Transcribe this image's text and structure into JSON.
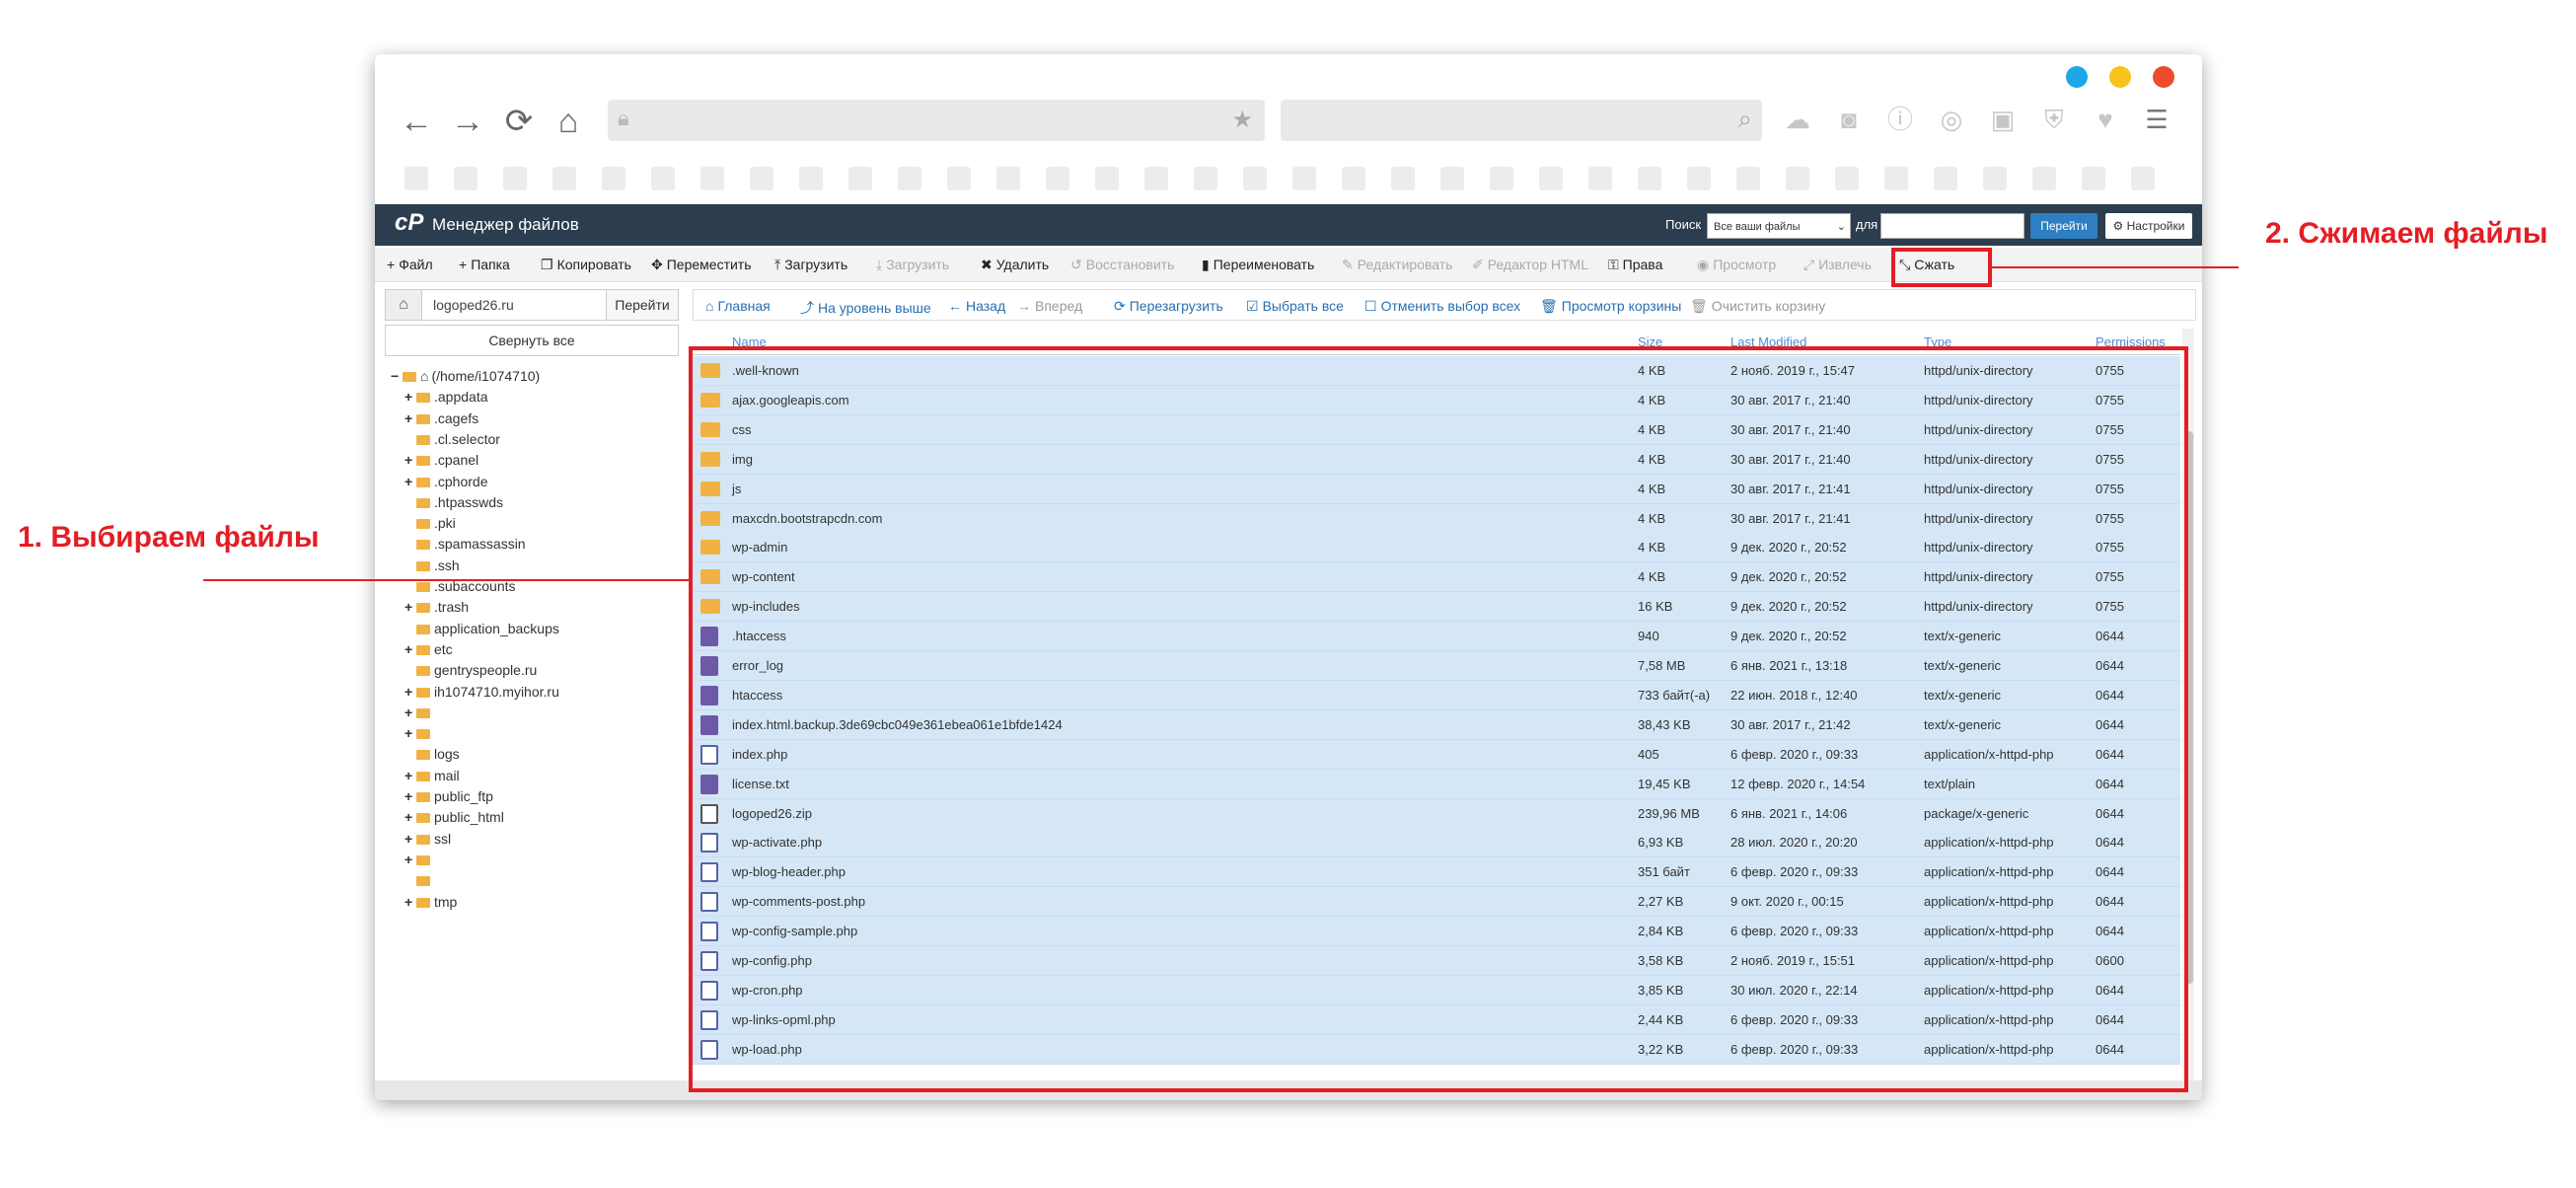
{
  "window_controls": {
    "blue": "#1ea7e8",
    "yellow": "#f7c21a",
    "red": "#ee4a2c"
  },
  "browser": {
    "nav_icons": [
      "back-arrow-icon",
      "forward-arrow-icon",
      "reload-icon",
      "home-icon"
    ],
    "toolbar_icons": [
      "download-cloud-icon",
      "camera-icon",
      "alert-icon",
      "broadcast-icon",
      "briefcase-icon",
      "shield-check-icon",
      "heart-icon",
      "hamburger-menu-icon"
    ]
  },
  "header": {
    "app_title": "Менеджер файлов",
    "search_label": "Поиск",
    "scope_value": "Все ваши файлы",
    "for_label": "для",
    "go_label": "Перейти",
    "settings_label": "Настройки"
  },
  "toolbar": [
    {
      "label": "Файл",
      "icon": "+",
      "disabled": false
    },
    {
      "label": "Папка",
      "icon": "+",
      "disabled": false
    },
    {
      "label": "Копировать",
      "icon": "❐",
      "disabled": false
    },
    {
      "label": "Переместить",
      "icon": "✥",
      "disabled": false
    },
    {
      "label": "Загрузить",
      "icon": "⤒",
      "disabled": false
    },
    {
      "label": "Загрузить",
      "icon": "⤓",
      "disabled": true
    },
    {
      "label": "Удалить",
      "icon": "✖",
      "disabled": false
    },
    {
      "label": "Восстановить",
      "icon": "↺",
      "disabled": true
    },
    {
      "label": "Переименовать",
      "icon": "▮",
      "disabled": false
    },
    {
      "label": "Редактировать",
      "icon": "✎",
      "disabled": true
    },
    {
      "label": "Редактор HTML",
      "icon": "✐",
      "disabled": true
    },
    {
      "label": "Права",
      "icon": "⚿",
      "disabled": false
    },
    {
      "label": "Просмотр",
      "icon": "◉",
      "disabled": true
    },
    {
      "label": "Извлечь",
      "icon": "⤢",
      "disabled": true
    },
    {
      "label": "Сжать",
      "icon": "⤡",
      "disabled": false
    }
  ],
  "sidebar": {
    "path_value": "logoped26.ru",
    "path_go": "Перейти",
    "collapse_all": "Свернуть все",
    "tree": [
      {
        "label": "(/home/i1074710)",
        "prefix": "−",
        "depth": 0
      },
      {
        "label": ".appdata",
        "prefix": "+",
        "depth": 1
      },
      {
        "label": ".cagefs",
        "prefix": "+",
        "depth": 1
      },
      {
        "label": ".cl.selector",
        "prefix": "",
        "depth": 1
      },
      {
        "label": ".cpanel",
        "prefix": "+",
        "depth": 1
      },
      {
        "label": ".cphorde",
        "prefix": "+",
        "depth": 1
      },
      {
        "label": ".htpasswds",
        "prefix": "",
        "depth": 1
      },
      {
        "label": ".pki",
        "prefix": "",
        "depth": 1
      },
      {
        "label": ".spamassassin",
        "prefix": "",
        "depth": 1
      },
      {
        "label": ".ssh",
        "prefix": "",
        "depth": 1
      },
      {
        "label": ".subaccounts",
        "prefix": "",
        "depth": 1
      },
      {
        "label": ".trash",
        "prefix": "+",
        "depth": 1
      },
      {
        "label": "application_backups",
        "prefix": "",
        "depth": 1
      },
      {
        "label": "etc",
        "prefix": "+",
        "depth": 1
      },
      {
        "label": "gentryspeople.ru",
        "prefix": "",
        "depth": 1
      },
      {
        "label": "ih1074710.myihor.ru",
        "prefix": "+",
        "depth": 1
      },
      {
        "label": "",
        "prefix": "+",
        "depth": 1
      },
      {
        "label": "",
        "prefix": "+",
        "depth": 1
      },
      {
        "label": "logs",
        "prefix": "",
        "depth": 1
      },
      {
        "label": "mail",
        "prefix": "+",
        "depth": 1
      },
      {
        "label": "public_ftp",
        "prefix": "+",
        "depth": 1
      },
      {
        "label": "public_html",
        "prefix": "+",
        "depth": 1
      },
      {
        "label": "ssl",
        "prefix": "+",
        "depth": 1
      },
      {
        "label": "",
        "prefix": "+",
        "depth": 1
      },
      {
        "label": "",
        "prefix": "",
        "depth": 1
      },
      {
        "label": "tmp",
        "prefix": "+",
        "depth": 1
      }
    ]
  },
  "navbar": [
    {
      "label": "Главная",
      "icon": "⌂",
      "disabled": false
    },
    {
      "label": "На уровень выше",
      "icon": "⤴",
      "disabled": false
    },
    {
      "label": "Назад",
      "icon": "←",
      "disabled": false
    },
    {
      "label": "Вперед",
      "icon": "→",
      "disabled": true
    },
    {
      "label": "Перезагрузить",
      "icon": "⟳",
      "disabled": false
    },
    {
      "label": "Выбрать все",
      "icon": "☑",
      "disabled": false
    },
    {
      "label": "Отменить выбор всех",
      "icon": "☐",
      "disabled": false
    },
    {
      "label": "Просмотр корзины",
      "icon": "🗑",
      "disabled": false
    },
    {
      "label": "Очистить корзину",
      "icon": "🗑",
      "disabled": true
    }
  ],
  "table": {
    "columns": [
      "Name",
      "Size",
      "Last Modified",
      "Type",
      "Permissions"
    ],
    "rows": [
      {
        "icon": "folder",
        "name": ".well-known",
        "size": "4 KB",
        "modified": "2 нояб. 2019 г., 15:47",
        "type": "httpd/unix-directory",
        "perm": "0755"
      },
      {
        "icon": "folder",
        "name": "ajax.googleapis.com",
        "size": "4 KB",
        "modified": "30 авг. 2017 г., 21:40",
        "type": "httpd/unix-directory",
        "perm": "0755"
      },
      {
        "icon": "folder",
        "name": "css",
        "size": "4 KB",
        "modified": "30 авг. 2017 г., 21:40",
        "type": "httpd/unix-directory",
        "perm": "0755"
      },
      {
        "icon": "folder",
        "name": "img",
        "size": "4 KB",
        "modified": "30 авг. 2017 г., 21:40",
        "type": "httpd/unix-directory",
        "perm": "0755"
      },
      {
        "icon": "folder",
        "name": "js",
        "size": "4 KB",
        "modified": "30 авг. 2017 г., 21:41",
        "type": "httpd/unix-directory",
        "perm": "0755"
      },
      {
        "icon": "folder",
        "name": "maxcdn.bootstrapcdn.com",
        "size": "4 KB",
        "modified": "30 авг. 2017 г., 21:41",
        "type": "httpd/unix-directory",
        "perm": "0755"
      },
      {
        "icon": "folder",
        "name": "wp-admin",
        "size": "4 KB",
        "modified": "9 дек. 2020 г., 20:52",
        "type": "httpd/unix-directory",
        "perm": "0755"
      },
      {
        "icon": "folder",
        "name": "wp-content",
        "size": "4 KB",
        "modified": "9 дек. 2020 г., 20:52",
        "type": "httpd/unix-directory",
        "perm": "0755"
      },
      {
        "icon": "folder",
        "name": "wp-includes",
        "size": "16 KB",
        "modified": "9 дек. 2020 г., 20:52",
        "type": "httpd/unix-directory",
        "perm": "0755"
      },
      {
        "icon": "text",
        "name": ".htaccess",
        "size": "940",
        "modified": "9 дек. 2020 г., 20:52",
        "type": "text/x-generic",
        "perm": "0644"
      },
      {
        "icon": "text",
        "name": "error_log",
        "size": "7,58 MB",
        "modified": "6 янв. 2021 г., 13:18",
        "type": "text/x-generic",
        "perm": "0644"
      },
      {
        "icon": "text",
        "name": "htaccess",
        "size": "733 байт(-а)",
        "modified": "22 июн. 2018 г., 12:40",
        "type": "text/x-generic",
        "perm": "0644"
      },
      {
        "icon": "text",
        "name": "index.html.backup.3de69cbc049e361ebea061e1bfde1424",
        "size": "38,43 KB",
        "modified": "30 авг. 2017 г., 21:42",
        "type": "text/x-generic",
        "perm": "0644"
      },
      {
        "icon": "php",
        "name": "index.php",
        "size": "405",
        "modified": "6 февр. 2020 г., 09:33",
        "type": "application/x-httpd-php",
        "perm": "0644"
      },
      {
        "icon": "text",
        "name": "license.txt",
        "size": "19,45 KB",
        "modified": "12 февр. 2020 г., 14:54",
        "type": "text/plain",
        "perm": "0644"
      },
      {
        "icon": "zip",
        "name": "logoped26.zip",
        "size": "239,96 MB",
        "modified": "6 янв. 2021 г., 14:06",
        "type": "package/x-generic",
        "perm": "0644"
      },
      {
        "icon": "php",
        "name": "wp-activate.php",
        "size": "6,93 KB",
        "modified": "28 июл. 2020 г., 20:20",
        "type": "application/x-httpd-php",
        "perm": "0644"
      },
      {
        "icon": "php",
        "name": "wp-blog-header.php",
        "size": "351 байт",
        "modified": "6 февр. 2020 г., 09:33",
        "type": "application/x-httpd-php",
        "perm": "0644"
      },
      {
        "icon": "php",
        "name": "wp-comments-post.php",
        "size": "2,27 KB",
        "modified": "9 окт. 2020 г., 00:15",
        "type": "application/x-httpd-php",
        "perm": "0644"
      },
      {
        "icon": "php",
        "name": "wp-config-sample.php",
        "size": "2,84 KB",
        "modified": "6 февр. 2020 г., 09:33",
        "type": "application/x-httpd-php",
        "perm": "0644"
      },
      {
        "icon": "php",
        "name": "wp-config.php",
        "size": "3,58 KB",
        "modified": "2 нояб. 2019 г., 15:51",
        "type": "application/x-httpd-php",
        "perm": "0600"
      },
      {
        "icon": "php",
        "name": "wp-cron.php",
        "size": "3,85 KB",
        "modified": "30 июл. 2020 г., 22:14",
        "type": "application/x-httpd-php",
        "perm": "0644"
      },
      {
        "icon": "php",
        "name": "wp-links-opml.php",
        "size": "2,44 KB",
        "modified": "6 февр. 2020 г., 09:33",
        "type": "application/x-httpd-php",
        "perm": "0644"
      },
      {
        "icon": "php",
        "name": "wp-load.php",
        "size": "3,22 KB",
        "modified": "6 февр. 2020 г., 09:33",
        "type": "application/x-httpd-php",
        "perm": "0644"
      }
    ]
  },
  "annotations": {
    "step1": "1. Выбираем файлы",
    "step2": "2. Сжимаем файлы",
    "color": "#e31e24"
  }
}
